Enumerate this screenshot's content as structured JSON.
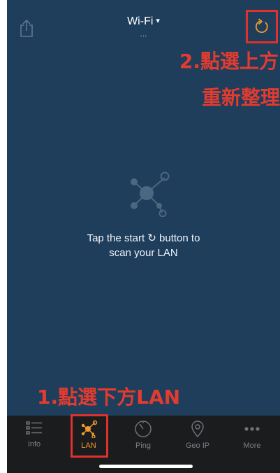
{
  "header": {
    "title": "Wi-Fi",
    "title_caret": "▾",
    "subtitle": "...",
    "share_icon": "share-icon",
    "refresh_icon": "refresh-icon"
  },
  "annotations": {
    "top_line1": "2.點選上方",
    "top_line2": "重新整理",
    "bottom": "1.點選下方LAN"
  },
  "empty_state": {
    "line1": "Tap the start ↻ button to",
    "line2": "scan your LAN",
    "icon": "network-nodes-icon"
  },
  "tabs": [
    {
      "label": "Info",
      "icon": "list-icon",
      "active": false
    },
    {
      "label": "LAN",
      "icon": "network-icon",
      "active": true
    },
    {
      "label": "Ping",
      "icon": "gauge-icon",
      "active": false
    },
    {
      "label": "Geo IP",
      "icon": "location-pin-icon",
      "active": false
    },
    {
      "label": "More",
      "icon": "more-dots-icon",
      "active": false
    }
  ],
  "colors": {
    "background": "#1e3e5c",
    "accent": "#f39a2c",
    "annotation": "#e33b2f",
    "tabbar": "#1b1c1e"
  }
}
